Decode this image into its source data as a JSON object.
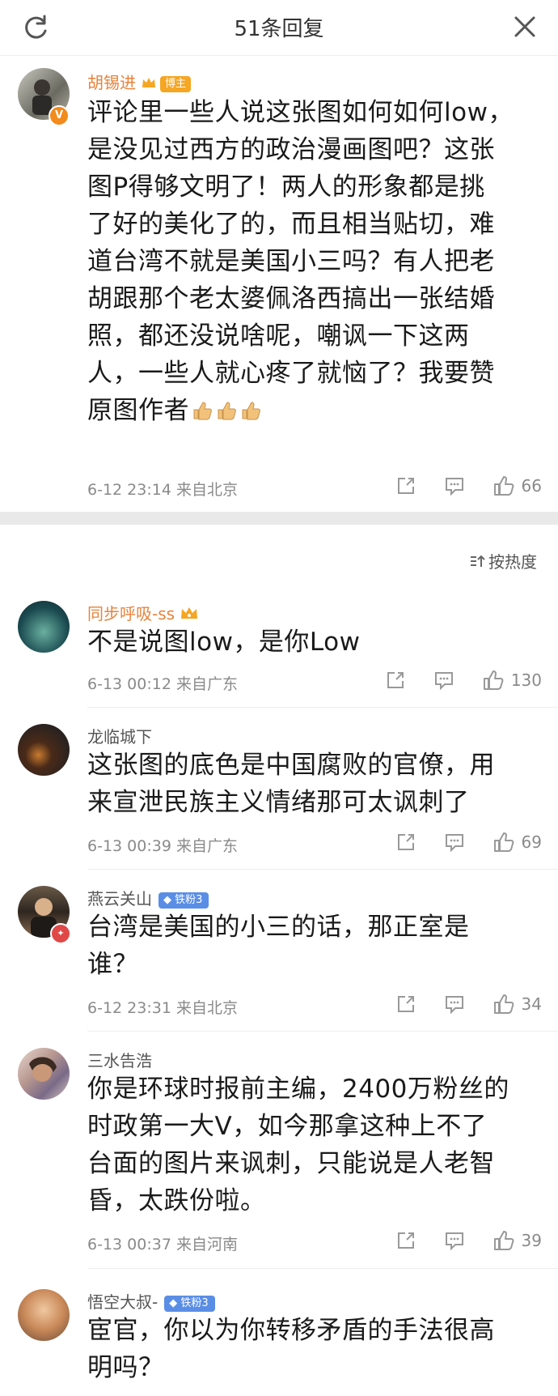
{
  "header": {
    "title": "51条回复"
  },
  "sort_label": "按热度",
  "main_comment": {
    "author": "胡锡进",
    "author_badge": "博主",
    "text_lines": [
      "评论里一些人说这张图如何如何low，",
      "是没见过西方的政治漫画图吧？这张",
      "图P得够文明了！两人的形象都是挑",
      "了好的美化了的，而且相当贴切，难",
      "道台湾不就是美国小三吗？有人把老",
      "胡跟那个老太婆佩洛西搞出一张结婚",
      "照，都还没说啥呢，嘲讽一下这两",
      "人，一些人就心疼了就恼了？我要赞",
      "原图作者"
    ],
    "time": "6-12 23:14",
    "location": "来自北京",
    "likes": "66"
  },
  "replies": [
    {
      "author": "同步呼吸-ss",
      "highlight": true,
      "fan_badge": "",
      "text_lines": [
        "不是说图low，是你Low"
      ],
      "time": "6-13 00:12",
      "location": "来自广东",
      "likes": "130"
    },
    {
      "author": "龙临城下",
      "highlight": false,
      "fan_badge": "",
      "text_lines": [
        "这张图的底色是中国腐败的官僚，用",
        "来宣泄民族主义情绪那可太讽刺了"
      ],
      "time": "6-13 00:39",
      "location": "来自广东",
      "likes": "69"
    },
    {
      "author": "燕云关山",
      "highlight": false,
      "fan_badge": "铁粉3",
      "text_lines": [
        "台湾是美国的小三的话，那正室是",
        "谁？"
      ],
      "time": "6-12 23:31",
      "location": "来自北京",
      "likes": "34"
    },
    {
      "author": "三水告浩",
      "highlight": false,
      "fan_badge": "",
      "text_lines": [
        "你是环球时报前主编，2400万粉丝的",
        "时政第一大V，如今那拿这种上不了",
        "台面的图片来讽刺，只能说是人老智",
        "昏，太跌份啦。"
      ],
      "time": "6-13 00:37",
      "location": "来自河南",
      "likes": "39"
    },
    {
      "author": "悟空大叔-",
      "highlight": false,
      "fan_badge": "铁粉3",
      "text_lines": [
        "宦官，你以为你转移矛盾的手法很高",
        "明吗？"
      ],
      "time": "",
      "location": "",
      "likes": ""
    }
  ]
}
